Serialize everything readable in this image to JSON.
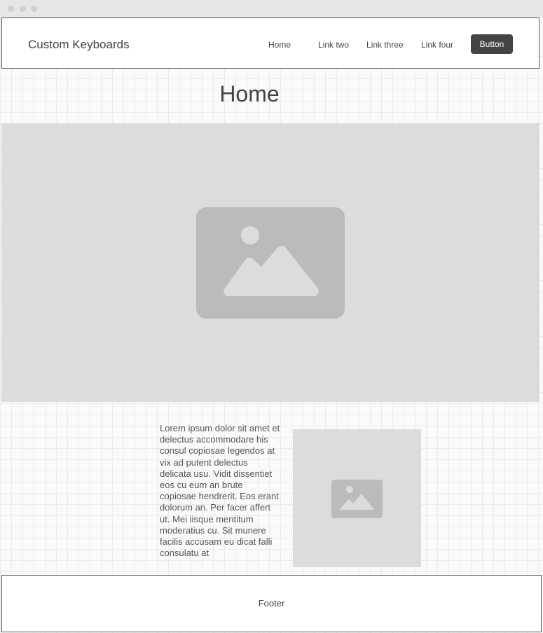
{
  "header": {
    "brand": "Custom Keyboards",
    "links": [
      "Home",
      "Link two",
      "Link three",
      "Link four"
    ],
    "button": "Button"
  },
  "main": {
    "title": "Home",
    "body_text": "Lorem ipsum dolor sit amet et delectus accommodare his consul copiosae legendos at vix ad putent delectus delicata usu. Vidit dissentiet eos cu eum an brute copiosae hendrerit. Eos erant dolorum an. Per facer affert ut. Mei iisque mentitum moderatius cu. Sit munere facilis accusam eu dicat falli consulatu at"
  },
  "footer": {
    "label": "Footer"
  },
  "icons": {
    "hero": "image-placeholder-icon",
    "side": "image-placeholder-icon"
  },
  "colors": {
    "primary_button": "#444444",
    "placeholder_bg": "#dcdcdc",
    "placeholder_icon": "#bbbbbb"
  }
}
